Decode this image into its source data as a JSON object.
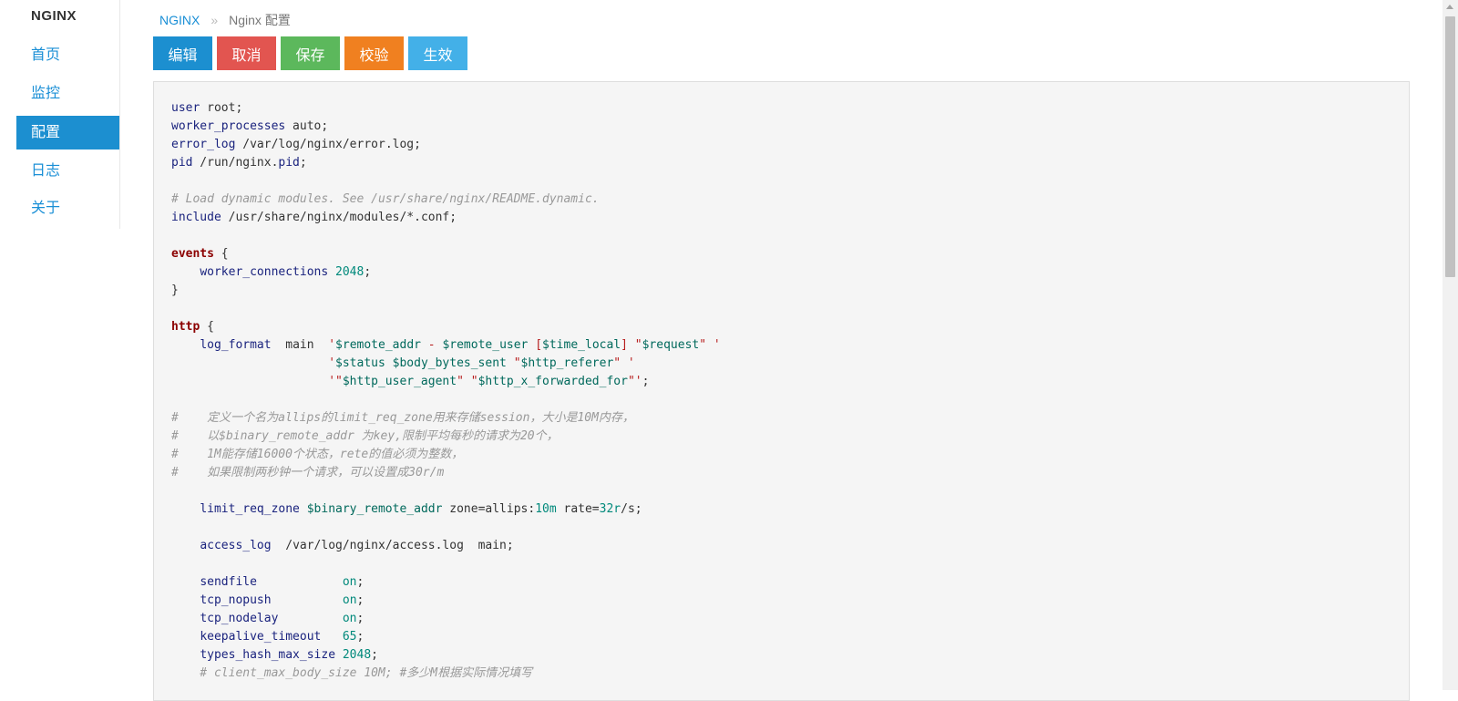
{
  "sidebar": {
    "brand": "NGINX",
    "items": [
      {
        "label": "首页",
        "active": false
      },
      {
        "label": "监控",
        "active": false
      },
      {
        "label": "配置",
        "active": true
      },
      {
        "label": "日志",
        "active": false
      },
      {
        "label": "关于",
        "active": false
      }
    ]
  },
  "breadcrumb": {
    "root": "NGINX",
    "separator": "»",
    "current": "Nginx 配置"
  },
  "toolbar": {
    "buttons": [
      {
        "label": "编辑",
        "color": "#1c8fd0"
      },
      {
        "label": "取消",
        "color": "#e25550"
      },
      {
        "label": "保存",
        "color": "#5cb85c"
      },
      {
        "label": "校验",
        "color": "#f08020"
      },
      {
        "label": "生效",
        "color": "#43b0e8"
      }
    ]
  },
  "editor": {
    "lines": [
      "user root;",
      "worker_processes auto;",
      "error_log /var/log/nginx/error.log;",
      "pid /run/nginx.pid;",
      "",
      "# Load dynamic modules. See /usr/share/nginx/README.dynamic.",
      "include /usr/share/nginx/modules/*.conf;",
      "",
      "events {",
      "    worker_connections 2048;",
      "}",
      "",
      "http {",
      "    log_format  main  '$remote_addr - $remote_user [$time_local] \"$request\" '",
      "                      '$status $body_bytes_sent \"$http_referer\" '",
      "                      '\"$http_user_agent\" \"$http_x_forwarded_for\"';",
      "",
      "#    定义一个名为allips的limit_req_zone用来存储session，大小是10M内存，",
      "#    以$binary_remote_addr 为key,限制平均每秒的请求为20个，",
      "#    1M能存储16000个状态，rete的值必须为整数，",
      "#    如果限制两秒钟一个请求，可以设置成30r/m",
      "",
      "    limit_req_zone $binary_remote_addr zone=allips:10m rate=32r/s;",
      "",
      "    access_log  /var/log/nginx/access.log  main;",
      "",
      "    sendfile            on;",
      "    tcp_nopush          on;",
      "    tcp_nodelay         on;",
      "    keepalive_timeout   65;",
      "    types_hash_max_size 2048;",
      "    # client_max_body_size 10M; #多少M根据实际情况填写"
    ]
  }
}
